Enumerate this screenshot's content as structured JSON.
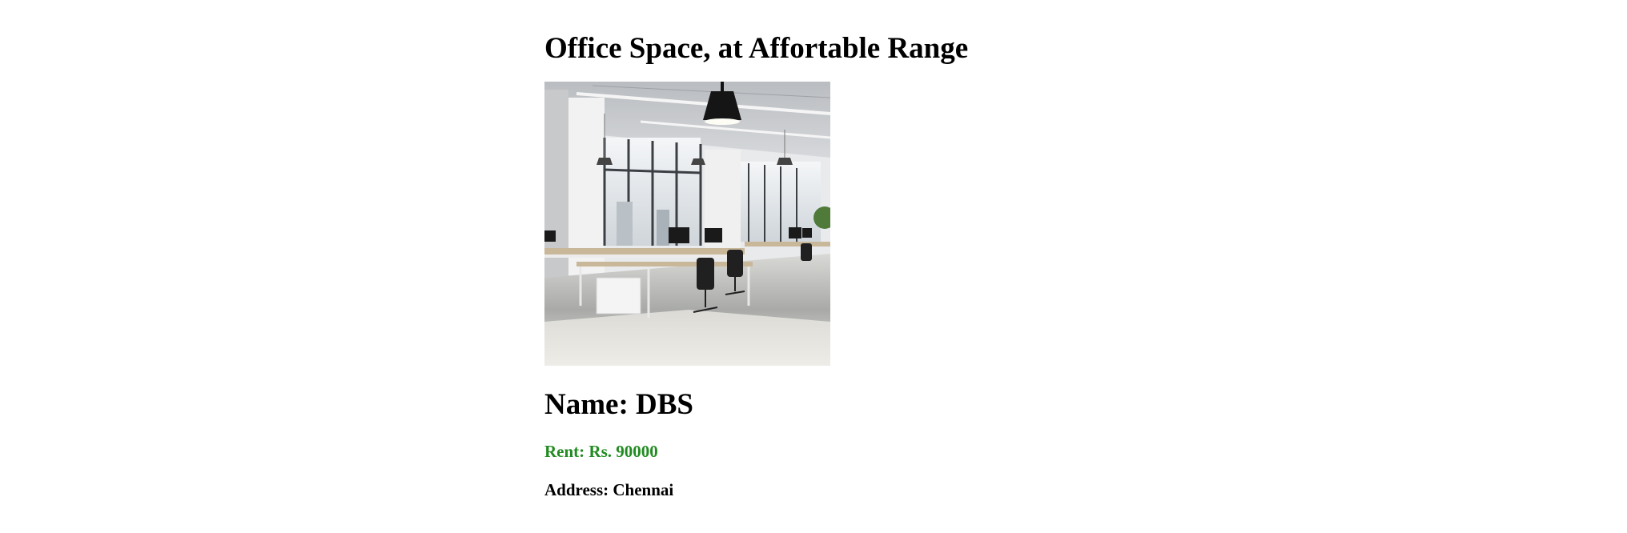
{
  "listing": {
    "title": "Office Space, at Affortable Range",
    "name": "Name: DBS",
    "rent": "Rent: Rs. 90000",
    "address": "Address: Chennai"
  },
  "colors": {
    "rent_text": "#228b22"
  }
}
